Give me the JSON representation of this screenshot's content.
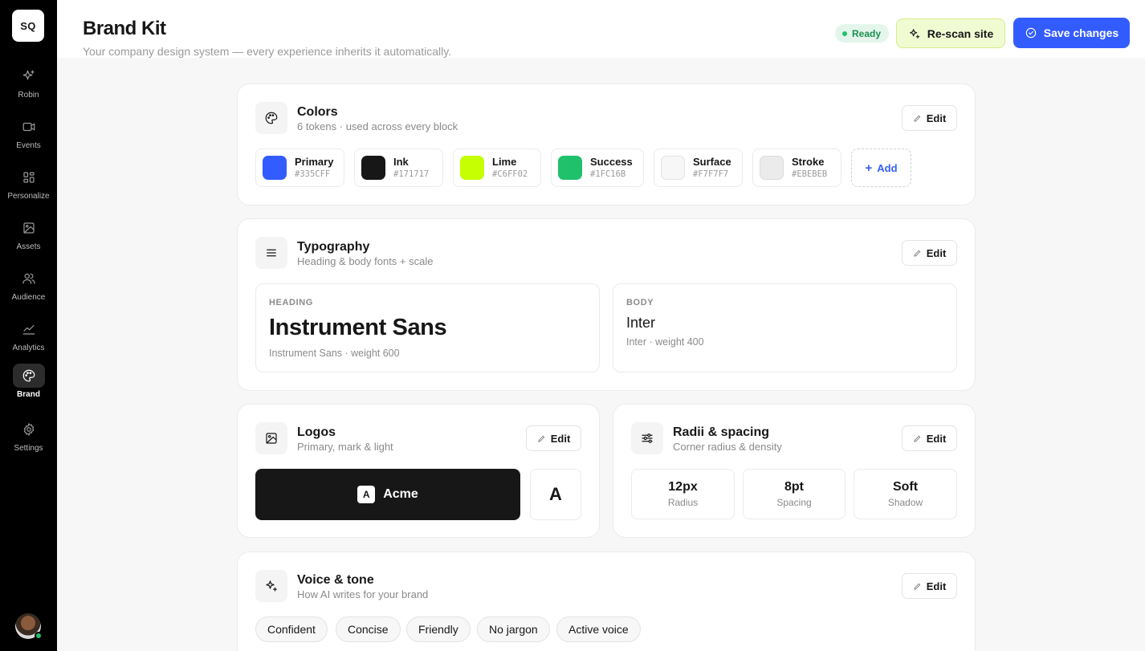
{
  "app": {
    "logo_text": "SQ"
  },
  "sidebar": {
    "items": [
      {
        "label": "Robin",
        "icon": "sparkles-icon"
      },
      {
        "label": "Events",
        "icon": "video-icon"
      },
      {
        "label": "Personalize",
        "icon": "grid-icon"
      },
      {
        "label": "Assets",
        "icon": "image-icon"
      },
      {
        "label": "Audience",
        "icon": "users-icon"
      },
      {
        "label": "Analytics",
        "icon": "chart-line-icon"
      },
      {
        "label": "Brand",
        "icon": "palette-icon",
        "active": true
      },
      {
        "label": "Settings",
        "icon": "gear-icon"
      }
    ]
  },
  "header": {
    "title": "Brand Kit",
    "subtitle": "Your company design system — every experience inherits it automatically.",
    "status": "Ready",
    "rescan_label": "Re-scan site",
    "save_label": "Save changes"
  },
  "colors_card": {
    "title": "Colors",
    "subtitle": "6 tokens · used across every block",
    "edit_label": "Edit",
    "add_label": "Add",
    "tokens": [
      {
        "name": "Primary",
        "hex": "#335CFF"
      },
      {
        "name": "Ink",
        "hex": "#171717"
      },
      {
        "name": "Lime",
        "hex": "#C6FF02"
      },
      {
        "name": "Success",
        "hex": "#1FC16B"
      },
      {
        "name": "Surface",
        "hex": "#F7F7F7"
      },
      {
        "name": "Stroke",
        "hex": "#EBEBEB"
      }
    ]
  },
  "typography_card": {
    "title": "Typography",
    "subtitle": "Heading & body fonts + scale",
    "edit_label": "Edit",
    "heading": {
      "label": "HEADING",
      "sample": "Instrument Sans",
      "meta": "Instrument Sans · weight 600"
    },
    "body": {
      "label": "BODY",
      "sample": "Inter",
      "meta": "Inter · weight 400"
    }
  },
  "logos_card": {
    "title": "Logos",
    "subtitle": "Primary, mark & light",
    "edit_label": "Edit",
    "primary_mark": "A",
    "primary_name": "Acme",
    "mark": "A"
  },
  "radii_card": {
    "title": "Radii & spacing",
    "subtitle": "Corner radius & density",
    "edit_label": "Edit",
    "metrics": [
      {
        "value": "12px",
        "label": "Radius"
      },
      {
        "value": "8pt",
        "label": "Spacing"
      },
      {
        "value": "Soft",
        "label": "Shadow"
      }
    ]
  },
  "voice_card": {
    "title": "Voice & tone",
    "subtitle": "How AI writes for your brand",
    "edit_label": "Edit",
    "chips": [
      "Confident",
      "Concise",
      "Friendly",
      "No jargon",
      "Active voice"
    ]
  }
}
